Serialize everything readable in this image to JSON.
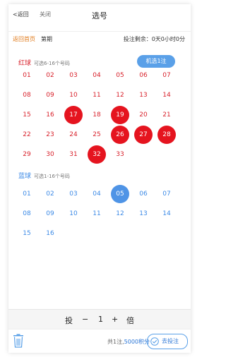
{
  "header": {
    "back": "返回",
    "close": "关闭",
    "title": "选号"
  },
  "info": {
    "home": "返回首页",
    "period": "第期",
    "remaining": "投注剩余：0天0小时0分"
  },
  "red": {
    "label": "红球",
    "hint": "可选6-16个号码",
    "machine": "机选1注",
    "balls": [
      {
        "n": "01",
        "sel": false
      },
      {
        "n": "02",
        "sel": false
      },
      {
        "n": "03",
        "sel": false
      },
      {
        "n": "04",
        "sel": false
      },
      {
        "n": "05",
        "sel": false
      },
      {
        "n": "06",
        "sel": false
      },
      {
        "n": "07",
        "sel": false
      },
      {
        "n": "08",
        "sel": false
      },
      {
        "n": "09",
        "sel": false
      },
      {
        "n": "10",
        "sel": false
      },
      {
        "n": "11",
        "sel": false
      },
      {
        "n": "12",
        "sel": false
      },
      {
        "n": "13",
        "sel": false
      },
      {
        "n": "14",
        "sel": false
      },
      {
        "n": "15",
        "sel": false
      },
      {
        "n": "16",
        "sel": false
      },
      {
        "n": "17",
        "sel": true
      },
      {
        "n": "18",
        "sel": false
      },
      {
        "n": "19",
        "sel": true
      },
      {
        "n": "20",
        "sel": false
      },
      {
        "n": "21",
        "sel": false
      },
      {
        "n": "22",
        "sel": false
      },
      {
        "n": "23",
        "sel": false
      },
      {
        "n": "24",
        "sel": false
      },
      {
        "n": "25",
        "sel": false
      },
      {
        "n": "26",
        "sel": true
      },
      {
        "n": "27",
        "sel": true
      },
      {
        "n": "28",
        "sel": true
      },
      {
        "n": "29",
        "sel": false
      },
      {
        "n": "30",
        "sel": false
      },
      {
        "n": "31",
        "sel": false
      },
      {
        "n": "32",
        "sel": true
      },
      {
        "n": "33",
        "sel": false
      }
    ]
  },
  "blue": {
    "label": "蓝球",
    "hint": "可选1-16个号码",
    "balls": [
      {
        "n": "01",
        "sel": false
      },
      {
        "n": "02",
        "sel": false
      },
      {
        "n": "03",
        "sel": false
      },
      {
        "n": "04",
        "sel": false
      },
      {
        "n": "05",
        "sel": true
      },
      {
        "n": "06",
        "sel": false
      },
      {
        "n": "07",
        "sel": false
      },
      {
        "n": "08",
        "sel": false
      },
      {
        "n": "09",
        "sel": false
      },
      {
        "n": "10",
        "sel": false
      },
      {
        "n": "11",
        "sel": false
      },
      {
        "n": "12",
        "sel": false
      },
      {
        "n": "13",
        "sel": false
      },
      {
        "n": "14",
        "sel": false
      },
      {
        "n": "15",
        "sel": false
      },
      {
        "n": "16",
        "sel": false
      }
    ]
  },
  "multiplier": {
    "prefix": "投",
    "minus": "−",
    "value": "1",
    "plus": "+",
    "suffix": "倍"
  },
  "footer": {
    "total_prefix": "共1注,",
    "total_points": "5000积分",
    "submit": "去投注"
  }
}
